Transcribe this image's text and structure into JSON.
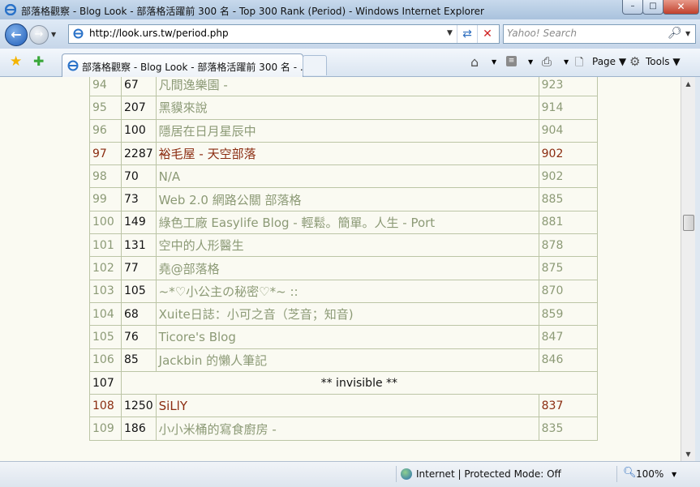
{
  "window": {
    "title": "部落格觀察 - Blog Look - 部落格活躍前 300 名 - Top 300 Rank (Period) - Windows Internet Explorer",
    "controls": {
      "minimize": "–",
      "maximize": "□",
      "close": "✕"
    }
  },
  "address_bar": {
    "url": "http://look.urs.tw/period.php",
    "search_placeholder": "Yahoo! Search"
  },
  "tab": {
    "label": "部落格觀察 - Blog Look - 部落格活躍前 300 名 - ..."
  },
  "command_bar": {
    "page_label": "Page",
    "tools_label": "Tools"
  },
  "table": {
    "rows": [
      {
        "rank": "94",
        "prev": "67",
        "name": "凡間逸樂園 -",
        "score": "923"
      },
      {
        "rank": "95",
        "prev": "207",
        "name": "黑貘來說",
        "score": "914"
      },
      {
        "rank": "96",
        "prev": "100",
        "name": "隱居在日月星辰中",
        "score": "904"
      },
      {
        "rank": "97",
        "prev": "2287",
        "name": "裕毛屋 - 天空部落",
        "score": "902"
      },
      {
        "rank": "98",
        "prev": "70",
        "name": "N/A",
        "score": "902"
      },
      {
        "rank": "99",
        "prev": "73",
        "name": "Web 2.0 網路公關 部落格",
        "score": "885"
      },
      {
        "rank": "100",
        "prev": "149",
        "name": "綠色工廠 Easylife Blog - 輕鬆。簡單。人生 - Port",
        "score": "881"
      },
      {
        "rank": "101",
        "prev": "131",
        "name": "空中的人形醫生",
        "score": "878"
      },
      {
        "rank": "102",
        "prev": "77",
        "name": "堯@部落格",
        "score": "875"
      },
      {
        "rank": "103",
        "prev": "105",
        "name": "~*♡小公主の秘密♡*~ ::",
        "score": "870"
      },
      {
        "rank": "104",
        "prev": "68",
        "name": "Xuite日誌：小可之音（芝音；知音)",
        "score": "859"
      },
      {
        "rank": "105",
        "prev": "76",
        "name": "Ticore's Blog",
        "score": "847"
      },
      {
        "rank": "106",
        "prev": "85",
        "name": "Jackbin 的懶人筆記",
        "score": "846"
      },
      {
        "rank": "107",
        "invisible": "** invisible **"
      },
      {
        "rank": "108",
        "prev": "1250",
        "name": "SiLlY",
        "score": "837"
      },
      {
        "rank": "109",
        "prev": "186",
        "name": "小小米桶的寫食廚房 -",
        "score": "835"
      }
    ]
  },
  "status_bar": {
    "zone": "Internet | Protected Mode: Off",
    "zoom": "100%"
  },
  "colors": {
    "row_text": "#8c9a76",
    "highlight_text": "#8b2c10",
    "border": "#bcc5a6",
    "content_bg": "#fafaf2"
  }
}
